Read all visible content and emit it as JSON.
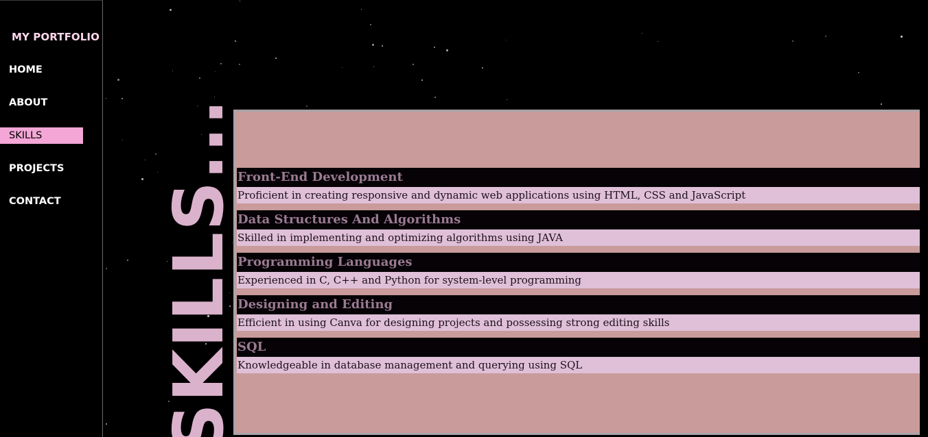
{
  "sidebar": {
    "brand": "MY PORTFOLIO",
    "items": [
      {
        "label": "HOME",
        "active": false
      },
      {
        "label": "ABOUT",
        "active": false
      },
      {
        "label": "SKILLS",
        "active": true
      },
      {
        "label": "PROJECTS",
        "active": false
      },
      {
        "label": "CONTACT",
        "active": false
      }
    ]
  },
  "main": {
    "heading": "SKILLS...",
    "skills": [
      {
        "name": "Front-End Development",
        "description": "Proficient in creating responsive and dynamic web applications using HTML, CSS and JavaScript"
      },
      {
        "name": "Data Structures And Algorithms",
        "description": "Skilled in implementing and optimizing algorithms using JAVA"
      },
      {
        "name": "Programming Languages",
        "description": "Experienced in C, C++ and Python for system-level programming"
      },
      {
        "name": "Designing and Editing",
        "description": "Efficient in using Canva for designing projects and possessing strong editing skills"
      },
      {
        "name": "SQL",
        "description": "Knowledgeable in database management and querying using SQL"
      }
    ]
  },
  "colors": {
    "accent": "#f4a6d6",
    "heading": "#dbb2cc",
    "panel": "#c99b9b",
    "description_bg": "#dfc0d8",
    "skill_name": "#9a7a92"
  }
}
